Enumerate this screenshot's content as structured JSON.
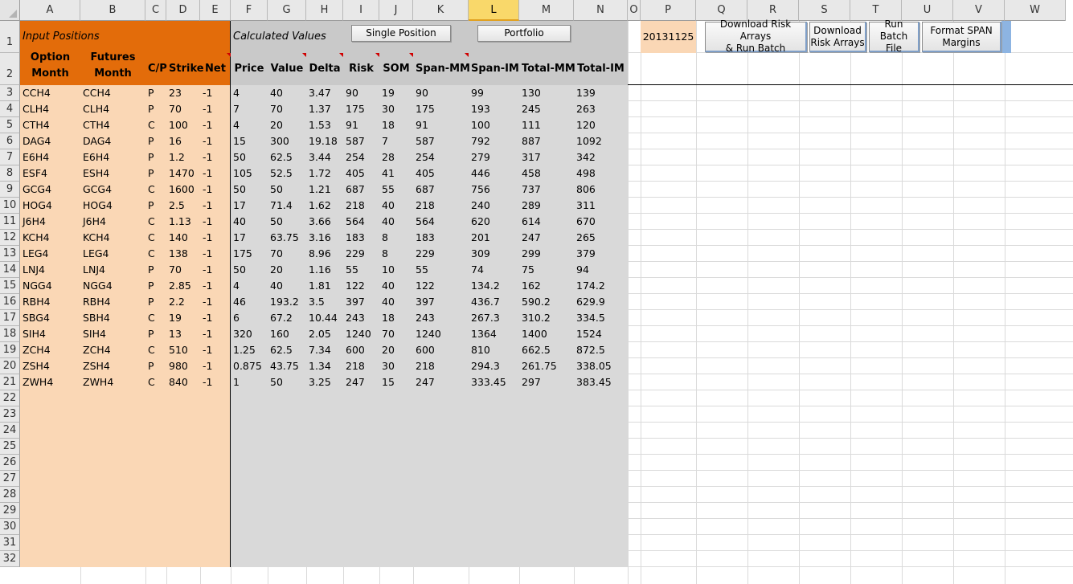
{
  "columns": [
    "A",
    "B",
    "C",
    "D",
    "E",
    "F",
    "G",
    "H",
    "I",
    "J",
    "K",
    "L",
    "M",
    "N",
    "O",
    "P",
    "Q",
    "R",
    "S",
    "T",
    "U",
    "V",
    "W"
  ],
  "selected_column": "L",
  "rows": [
    "1",
    "2",
    "3",
    "4",
    "5",
    "6",
    "7",
    "8",
    "9",
    "10",
    "11",
    "12",
    "13",
    "14",
    "15",
    "16",
    "17",
    "18",
    "19",
    "20",
    "21",
    "22",
    "23",
    "24",
    "25",
    "26",
    "27",
    "28",
    "29",
    "30",
    "31",
    "32"
  ],
  "header": {
    "input_positions": "Input Positions",
    "calculated_values": "Calculated Values",
    "date_value": "20131125"
  },
  "buttons": {
    "single_position": "Single Position",
    "portfolio": "Portfolio",
    "download_run_line1": "Download Risk Arrays",
    "download_run_line2": "& Run Batch",
    "download_line1": "Download",
    "download_line2": "Risk Arrays",
    "run_batch_line1": "Run Batch",
    "run_batch_line2": "File",
    "format_line1": "Format SPAN",
    "format_line2": "Margins"
  },
  "table": {
    "headers": {
      "option_l1": "Option",
      "option_l2": "Month",
      "futures_l1": "Futures",
      "futures_l2": "Month",
      "cp": "C/P",
      "strike": "Strike",
      "net": "Net",
      "price": "Price",
      "value": "Value",
      "delta": "Delta",
      "risk": "Risk",
      "som": "SOM",
      "span_mm": "Span-MM",
      "span_im": "Span-IM",
      "total_mm": "Total-MM",
      "total_im": "Total-IM"
    },
    "rows": [
      [
        "CCH4",
        "CCH4",
        "P",
        "23",
        "-1",
        "4",
        "40",
        "3.47",
        "90",
        "19",
        "90",
        "99",
        "130",
        "139"
      ],
      [
        "CLH4",
        "CLH4",
        "P",
        "70",
        "-1",
        "7",
        "70",
        "1.37",
        "175",
        "30",
        "175",
        "193",
        "245",
        "263"
      ],
      [
        "CTH4",
        "CTH4",
        "C",
        "100",
        "-1",
        "4",
        "20",
        "1.53",
        "91",
        "18",
        "91",
        "100",
        "111",
        "120"
      ],
      [
        "DAG4",
        "DAG4",
        "P",
        "16",
        "-1",
        "15",
        "300",
        "19.18",
        "587",
        "7",
        "587",
        "792",
        "887",
        "1092"
      ],
      [
        "E6H4",
        "E6H4",
        "P",
        "1.2",
        "-1",
        "50",
        "62.5",
        "3.44",
        "254",
        "28",
        "254",
        "279",
        "317",
        "342"
      ],
      [
        "ESF4",
        "ESH4",
        "P",
        "1470",
        "-1",
        "105",
        "52.5",
        "1.72",
        "405",
        "41",
        "405",
        "446",
        "458",
        "498"
      ],
      [
        "GCG4",
        "GCG4",
        "C",
        "1600",
        "-1",
        "50",
        "50",
        "1.21",
        "687",
        "55",
        "687",
        "756",
        "737",
        "806"
      ],
      [
        "HOG4",
        "HOG4",
        "P",
        "2.5",
        "-1",
        "17",
        "71.4",
        "1.62",
        "218",
        "40",
        "218",
        "240",
        "289",
        "311"
      ],
      [
        "J6H4",
        "J6H4",
        "C",
        "1.13",
        "-1",
        "40",
        "50",
        "3.66",
        "564",
        "40",
        "564",
        "620",
        "614",
        "670"
      ],
      [
        "KCH4",
        "KCH4",
        "C",
        "140",
        "-1",
        "17",
        "63.75",
        "3.16",
        "183",
        "8",
        "183",
        "201",
        "247",
        "265"
      ],
      [
        "LEG4",
        "LEG4",
        "C",
        "138",
        "-1",
        "175",
        "70",
        "8.96",
        "229",
        "8",
        "229",
        "309",
        "299",
        "379"
      ],
      [
        "LNJ4",
        "LNJ4",
        "P",
        "70",
        "-1",
        "50",
        "20",
        "1.16",
        "55",
        "10",
        "55",
        "74",
        "75",
        "94"
      ],
      [
        "NGG4",
        "NGG4",
        "P",
        "2.85",
        "-1",
        "4",
        "40",
        "1.81",
        "122",
        "40",
        "122",
        "134.2",
        "162",
        "174.2"
      ],
      [
        "RBH4",
        "RBH4",
        "P",
        "2.2",
        "-1",
        "46",
        "193.2",
        "3.5",
        "397",
        "40",
        "397",
        "436.7",
        "590.2",
        "629.9"
      ],
      [
        "SBG4",
        "SBH4",
        "C",
        "19",
        "-1",
        "6",
        "67.2",
        "10.44",
        "243",
        "18",
        "243",
        "267.3",
        "310.2",
        "334.5"
      ],
      [
        "SIH4",
        "SIH4",
        "P",
        "13",
        "-1",
        "320",
        "160",
        "2.05",
        "1240",
        "70",
        "1240",
        "1364",
        "1400",
        "1524"
      ],
      [
        "ZCH4",
        "ZCH4",
        "C",
        "510",
        "-1",
        "1.25",
        "62.5",
        "7.34",
        "600",
        "20",
        "600",
        "810",
        "662.5",
        "872.5"
      ],
      [
        "ZSH4",
        "ZSH4",
        "P",
        "980",
        "-1",
        "0.875",
        "43.75",
        "1.34",
        "218",
        "30",
        "218",
        "294.3",
        "261.75",
        "338.05"
      ],
      [
        "ZWH4",
        "ZWH4",
        "C",
        "840",
        "-1",
        "1",
        "50",
        "3.25",
        "247",
        "15",
        "247",
        "333.45",
        "297",
        "383.45"
      ]
    ]
  },
  "colors": {
    "orange": "#e36c0a",
    "peach": "#fad7b5",
    "gray": "#d9d9d9",
    "selection_blue": "#8db4e2",
    "comment_red": "#d00000"
  }
}
